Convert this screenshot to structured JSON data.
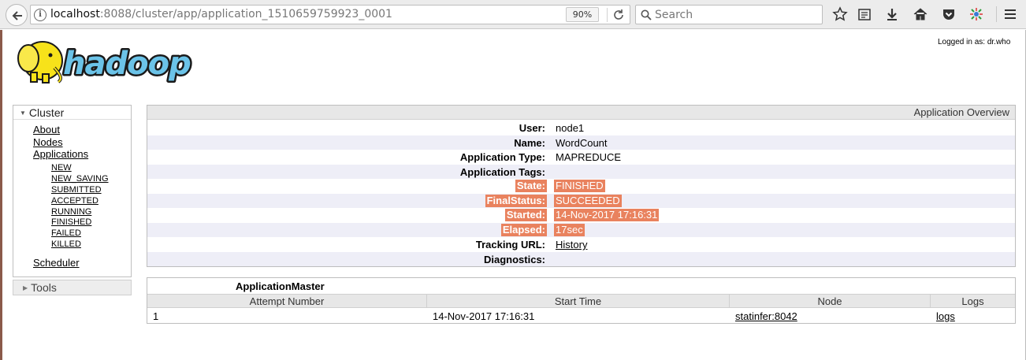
{
  "browser": {
    "url_host": "localhost",
    "url_rest": ":8088/cluster/app/application_1510659759923_0001",
    "zoom": "90%",
    "search_placeholder": "Search"
  },
  "header": {
    "logged_in": "Logged in as: dr.who",
    "logo_text": "hadoop"
  },
  "sidebar": {
    "cluster_label": "Cluster",
    "tools_label": "Tools",
    "links": [
      "About",
      "Nodes",
      "Applications"
    ],
    "app_states": [
      "NEW",
      "NEW_SAVING",
      "SUBMITTED",
      "ACCEPTED",
      "RUNNING",
      "FINISHED",
      "FAILED",
      "KILLED"
    ],
    "scheduler": "Scheduler"
  },
  "overview": {
    "title": "Application Overview",
    "rows": [
      {
        "label": "User:",
        "value": "node1"
      },
      {
        "label": "Name:",
        "value": "WordCount"
      },
      {
        "label": "Application Type:",
        "value": "MAPREDUCE"
      },
      {
        "label": "Application Tags:",
        "value": ""
      },
      {
        "label": "State:",
        "value": "FINISHED"
      },
      {
        "label": "FinalStatus:",
        "value": "SUCCEEDED"
      },
      {
        "label": "Started:",
        "value": "14-Nov-2017 17:16:31"
      },
      {
        "label": "Elapsed:",
        "value": "17sec"
      },
      {
        "label": "Tracking URL:",
        "value": "History"
      },
      {
        "label": "Diagnostics:",
        "value": ""
      }
    ],
    "highlight_color": "#e9825e"
  },
  "attempts": {
    "title": "ApplicationMaster",
    "columns": [
      "Attempt Number",
      "Start Time",
      "Node",
      "Logs"
    ],
    "rows": [
      {
        "attempt": "1",
        "start": "14-Nov-2017 17:16:31",
        "node": "statinfer:8042",
        "logs": "logs"
      }
    ]
  }
}
